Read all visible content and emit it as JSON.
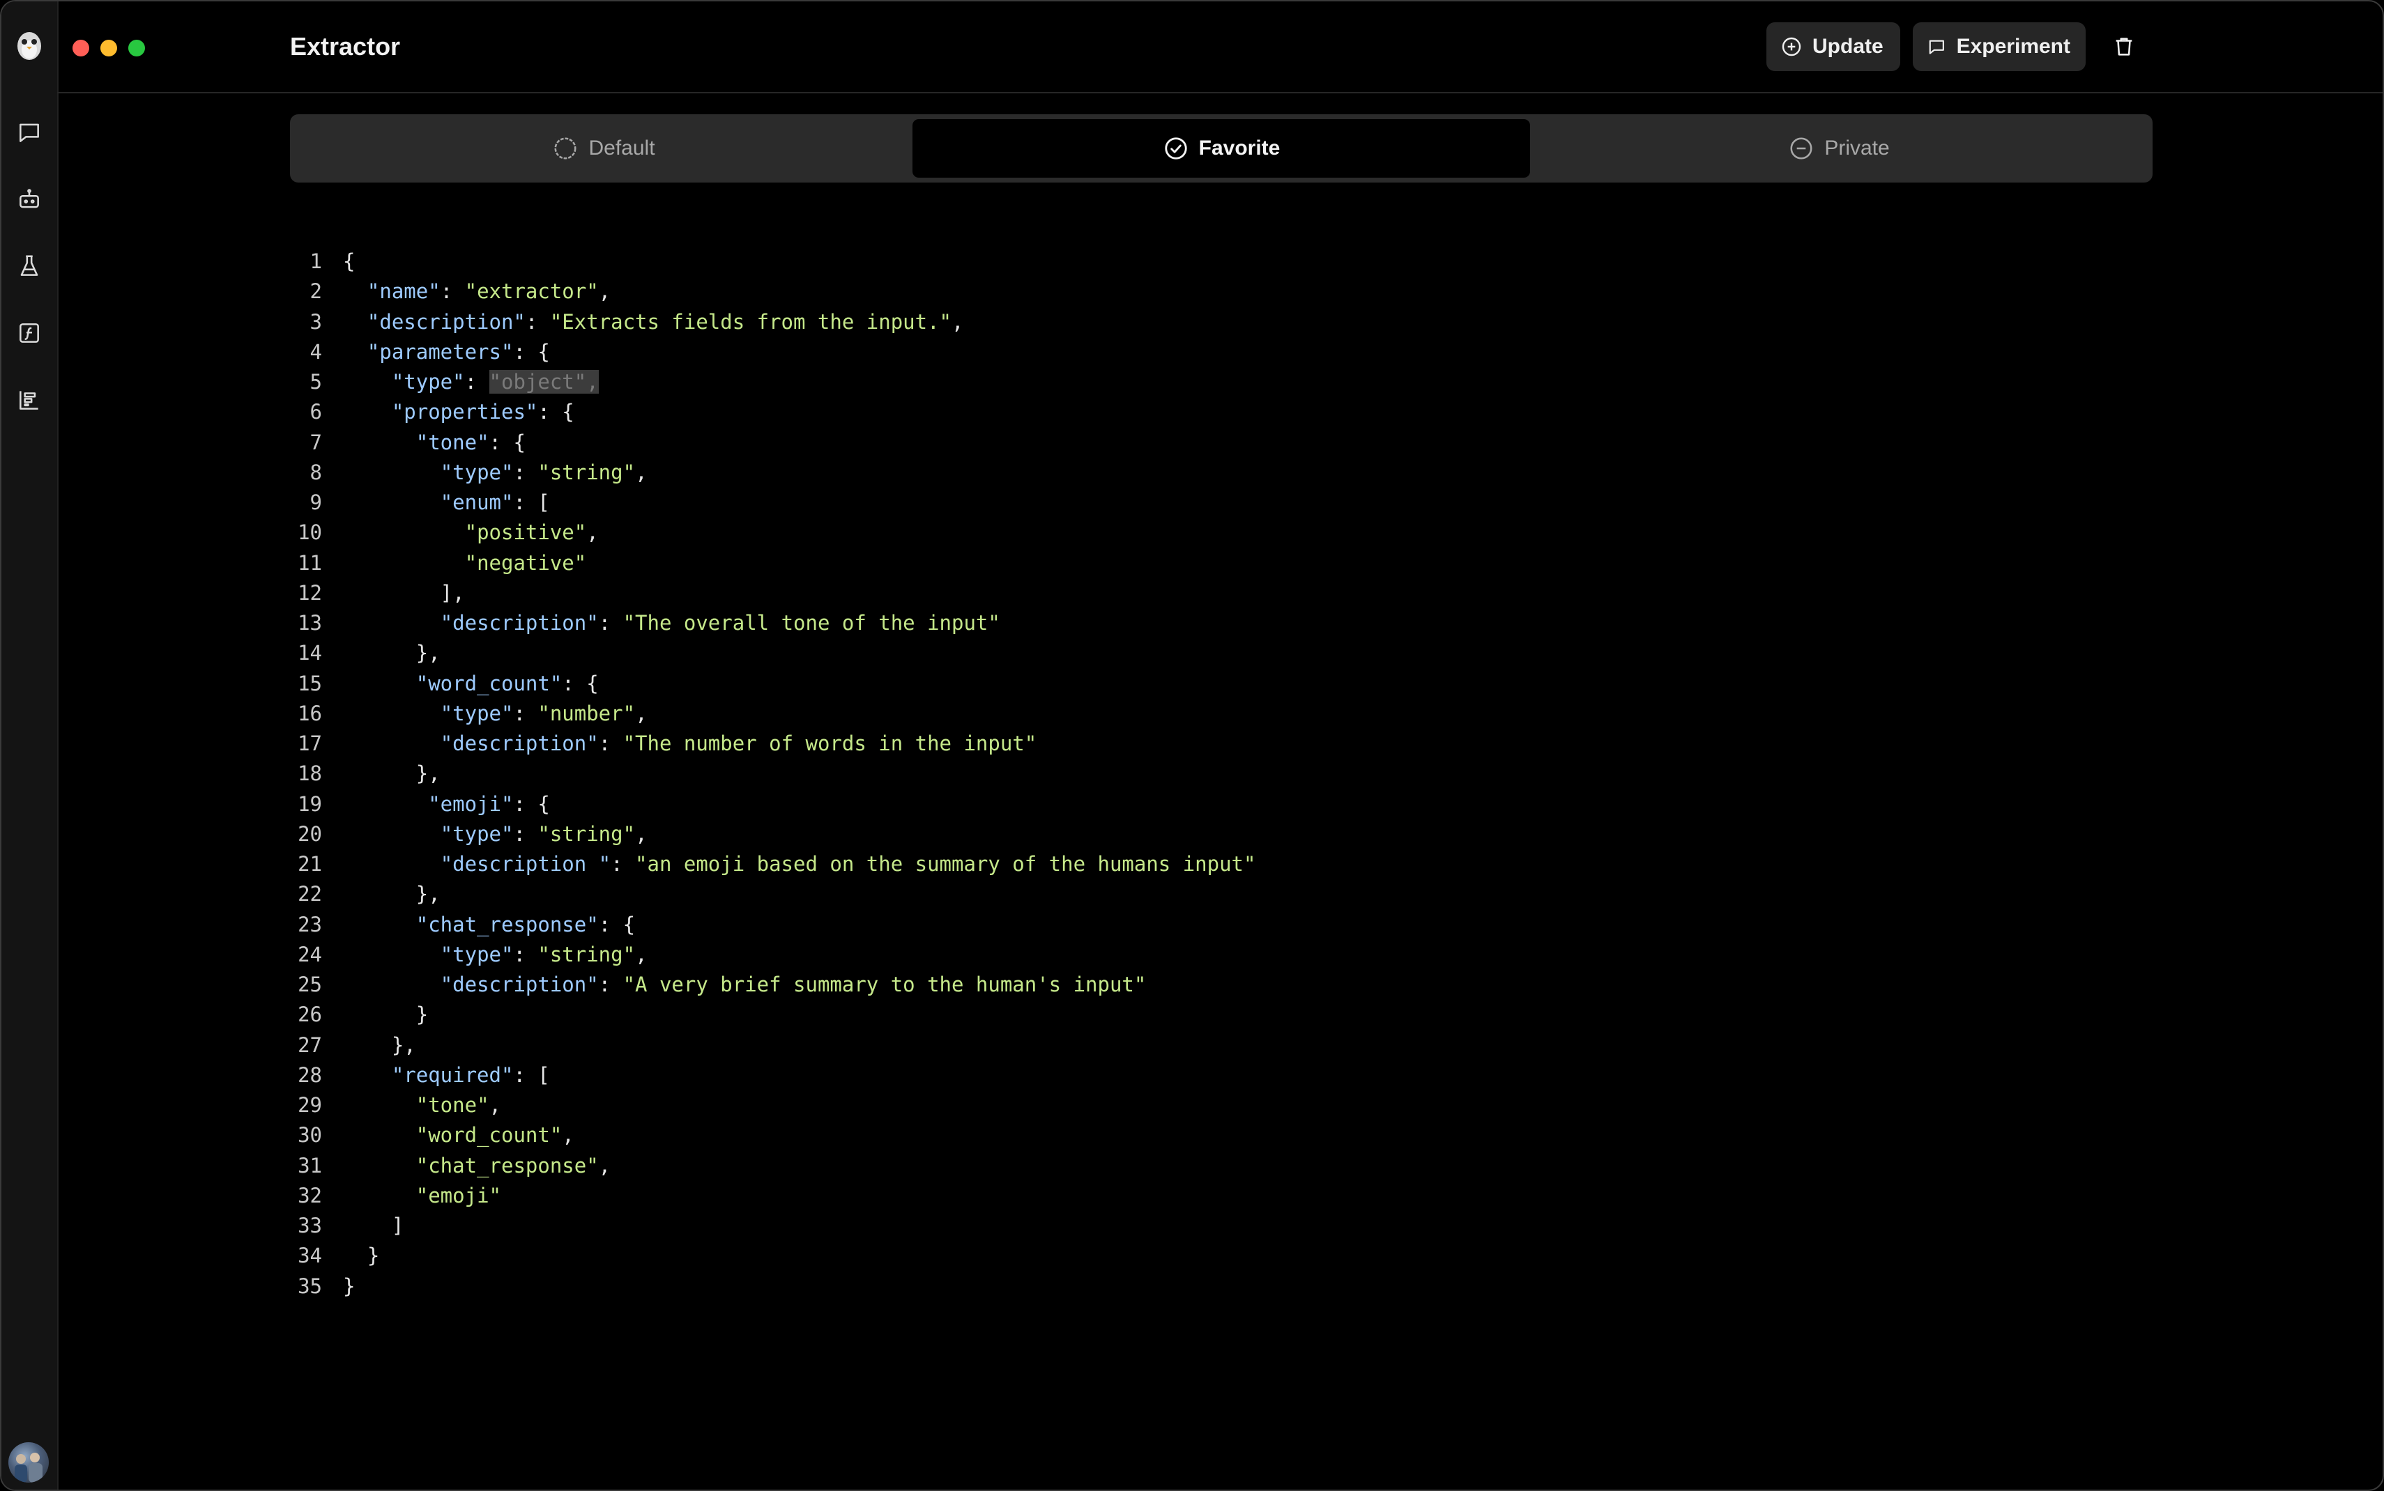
{
  "window": {
    "title": "Extractor"
  },
  "toolbar": {
    "update_label": "Update",
    "experiment_label": "Experiment"
  },
  "tabs": [
    {
      "label": "Default",
      "icon": "circle-icon",
      "active": false
    },
    {
      "label": "Favorite",
      "icon": "check-circle-icon",
      "active": true
    },
    {
      "label": "Private",
      "icon": "minus-circle-icon",
      "active": false
    }
  ],
  "sidebar": {
    "items": [
      {
        "name": "chat",
        "icon": "chat-bubble-icon"
      },
      {
        "name": "agents",
        "icon": "robot-icon"
      },
      {
        "name": "experiments",
        "icon": "flask-icon"
      },
      {
        "name": "functions",
        "icon": "function-icon"
      },
      {
        "name": "reports",
        "icon": "chart-bars-icon"
      }
    ]
  },
  "editor": {
    "lines": [
      {
        "n": "1",
        "t": "{"
      },
      {
        "n": "2",
        "t": "  \"name\": \"extractor\","
      },
      {
        "n": "3",
        "t": "  \"description\": \"Extracts fields from the input.\","
      },
      {
        "n": "4",
        "t": "  \"parameters\": {"
      },
      {
        "n": "5",
        "t": "    \"type\": \"object\","
      },
      {
        "n": "6",
        "t": "    \"properties\": {"
      },
      {
        "n": "7",
        "t": "      \"tone\": {"
      },
      {
        "n": "8",
        "t": "        \"type\": \"string\","
      },
      {
        "n": "9",
        "t": "        \"enum\": ["
      },
      {
        "n": "10",
        "t": "          \"positive\","
      },
      {
        "n": "11",
        "t": "          \"negative\""
      },
      {
        "n": "12",
        "t": "        ],"
      },
      {
        "n": "13",
        "t": "        \"description\": \"The overall tone of the input\""
      },
      {
        "n": "14",
        "t": "      },"
      },
      {
        "n": "15",
        "t": "      \"word_count\": {"
      },
      {
        "n": "16",
        "t": "        \"type\": \"number\","
      },
      {
        "n": "17",
        "t": "        \"description\": \"The number of words in the input\""
      },
      {
        "n": "18",
        "t": "      },"
      },
      {
        "n": "19",
        "t": "       \"emoji\": {"
      },
      {
        "n": "20",
        "t": "        \"type\": \"string\","
      },
      {
        "n": "21",
        "t": "        \"description \": \"an emoji based on the summary of the humans input\""
      },
      {
        "n": "22",
        "t": "      },"
      },
      {
        "n": "23",
        "t": "      \"chat_response\": {"
      },
      {
        "n": "24",
        "t": "        \"type\": \"string\","
      },
      {
        "n": "25",
        "t": "        \"description\": \"A very brief summary to the human's input\""
      },
      {
        "n": "26",
        "t": "      }"
      },
      {
        "n": "27",
        "t": "    },"
      },
      {
        "n": "28",
        "t": "    \"required\": ["
      },
      {
        "n": "29",
        "t": "      \"tone\","
      },
      {
        "n": "30",
        "t": "      \"word_count\","
      },
      {
        "n": "31",
        "t": "      \"chat_response\","
      },
      {
        "n": "32",
        "t": "      \"emoji\""
      },
      {
        "n": "33",
        "t": "    ]"
      },
      {
        "n": "34",
        "t": "  }"
      },
      {
        "n": "35",
        "t": "}"
      }
    ],
    "selected_line": "5",
    "selected_text": "\"object\","
  },
  "colors": {
    "key": "#9ecbff",
    "string": "#c5e88a",
    "punct": "#e6e6e6",
    "background": "#000000",
    "selection": "#3c3c3c"
  }
}
